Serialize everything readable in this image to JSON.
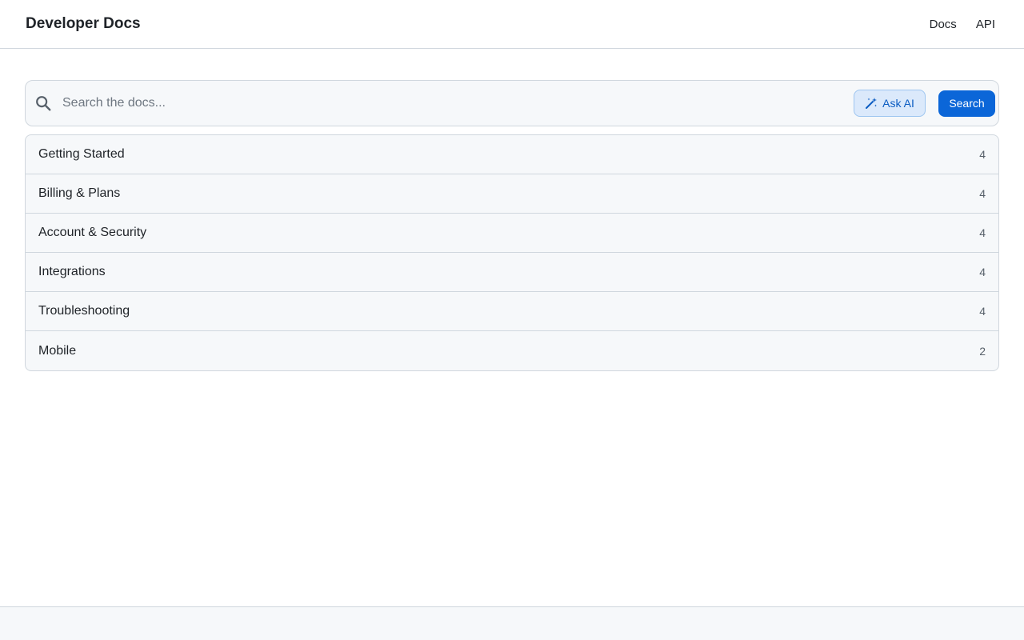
{
  "header": {
    "brand": "Developer Docs",
    "nav": [
      {
        "label": "Docs"
      },
      {
        "label": "API"
      }
    ]
  },
  "search": {
    "placeholder": "Search the docs...",
    "value": "",
    "ask_ai_label": "Ask AI",
    "ask_ai_icon": "magic-wand-icon",
    "search_label": "Search",
    "icon": "search-icon"
  },
  "categories": [
    {
      "name": "Getting Started",
      "count": "4"
    },
    {
      "name": "Billing & Plans",
      "count": "4"
    },
    {
      "name": "Account & Security",
      "count": "4"
    },
    {
      "name": "Integrations",
      "count": "4"
    },
    {
      "name": "Troubleshooting",
      "count": "4"
    },
    {
      "name": "Mobile",
      "count": "2"
    }
  ],
  "colors": {
    "accent": "#0b66d8",
    "ask_ai_bg": "#dbe9fb",
    "border": "#d0d7de",
    "surface": "#f6f8fa"
  }
}
